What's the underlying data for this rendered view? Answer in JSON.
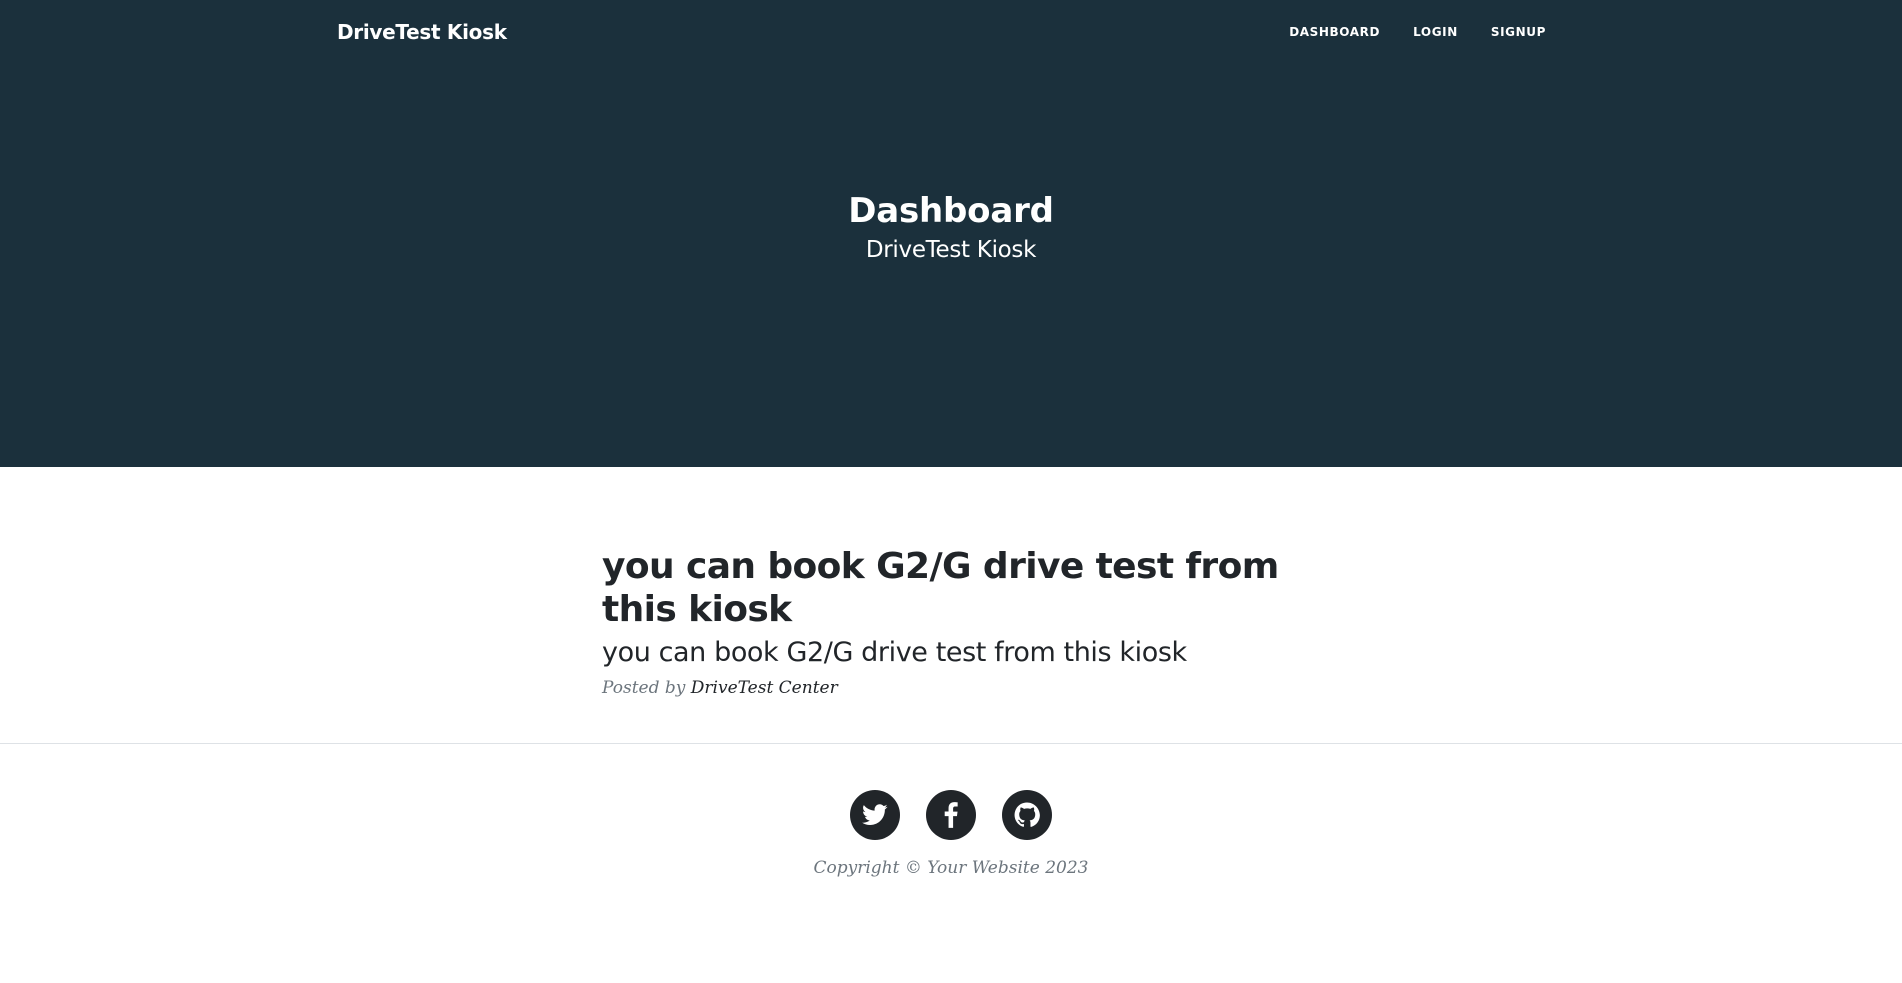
{
  "nav": {
    "brand": "DriveTest Kiosk",
    "links": [
      {
        "label": "DASHBOARD"
      },
      {
        "label": "LOGIN"
      },
      {
        "label": "SIGNUP"
      }
    ]
  },
  "header": {
    "title": "Dashboard",
    "subtitle": "DriveTest Kiosk",
    "background_color": "#1b303c"
  },
  "post": {
    "title": "you can book G2/G drive test from this kiosk",
    "subtitle": "you can book G2/G drive test from this kiosk",
    "meta_prefix": "Posted by",
    "author": "DriveTest Center"
  },
  "footer": {
    "social_icons": [
      "twitter-icon",
      "facebook-icon",
      "github-icon"
    ],
    "copyright": "Copyright © Your Website 2023"
  }
}
